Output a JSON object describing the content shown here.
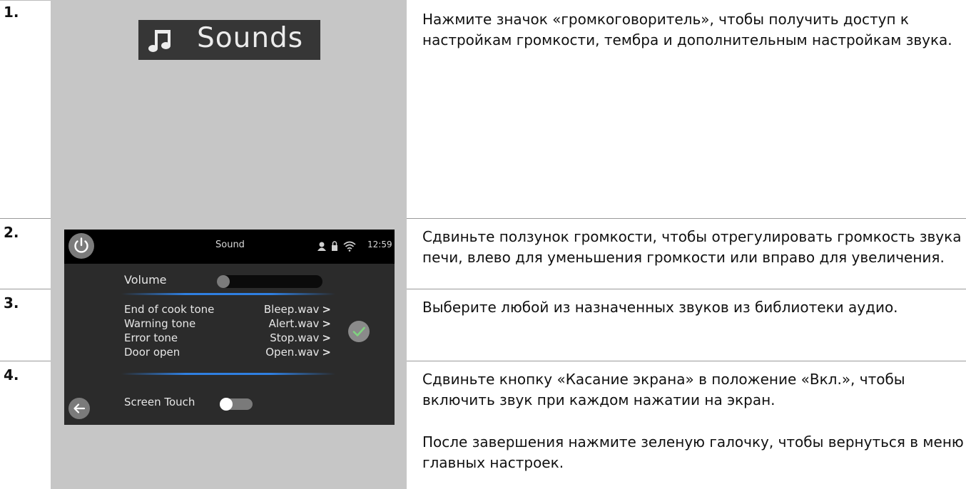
{
  "steps": [
    {
      "num": "1.",
      "text": "Нажмите значок «громкоговоритель», чтобы получить доступ к настройкам громкости, тембра и дополнительным настройкам звука."
    },
    {
      "num": "2.",
      "text": "Сдвиньте ползунок громкости, чтобы отрегулировать громкость звука печи, влево для уменьшения громкости или вправо для увеличения."
    },
    {
      "num": "3.",
      "text": "Выберите любой из назначенных звуков из библиотеки аудио."
    },
    {
      "num": "4.",
      "text": "Сдвиньте кнопку «Касание экрана» в положение «Вкл.», чтобы включить звук при каждом нажатии на экран.",
      "text2": "После завершения нажмите зеленую галочку, чтобы вернуться в меню главных настроек."
    }
  ],
  "sounds_button": {
    "label": "Sounds",
    "icon": "music-note-icon"
  },
  "device": {
    "title": "Sound",
    "time": "12:59",
    "status_icons": [
      "person-icon",
      "lock-icon",
      "wifi-icon"
    ],
    "volume_label": "Volume",
    "volume_level": 0,
    "tones": [
      {
        "name": "End of cook tone",
        "value": "Bleep.wav"
      },
      {
        "name": "Warning tone",
        "value": "Alert.wav"
      },
      {
        "name": "Error tone",
        "value": "Stop.wav"
      },
      {
        "name": "Door open",
        "value": "Open.wav"
      }
    ],
    "chevron": ">",
    "screen_touch_label": "Screen Touch",
    "screen_touch_on": false,
    "colors": {
      "accent_blue": "#2f7fe0",
      "check_green": "#7fd37f",
      "panel_bg": "#2b2b2b",
      "topbar_bg": "#000000"
    }
  }
}
